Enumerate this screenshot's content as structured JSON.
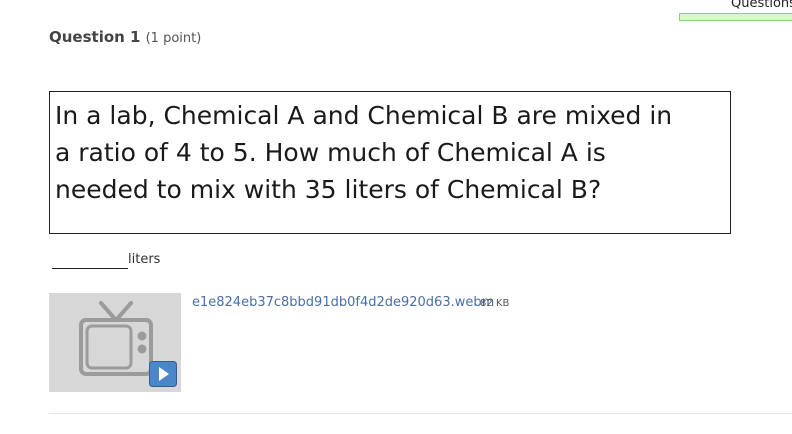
{
  "header": {
    "progress_label": "Questions",
    "progress_color": "#dcf5cf"
  },
  "question": {
    "title": "Question 1",
    "points": "(1 point)",
    "lines": [
      "In a lab, Chemical A and Chemical B are mixed in",
      "a ratio of 4 to 5. How much of Chemical A is",
      "needed to mix with 35 liters of Chemical B?"
    ]
  },
  "answer": {
    "value": "",
    "unit": "liters"
  },
  "attachment": {
    "thumbnail_icon": "tv-video-icon",
    "play_icon": "play-icon",
    "filename": "e1e824eb37c8bbd91db0f4d2de920d63.webm",
    "size": "82 KB"
  },
  "colors": {
    "link": "#4a6fa5",
    "play_button": "#4a86c8"
  }
}
